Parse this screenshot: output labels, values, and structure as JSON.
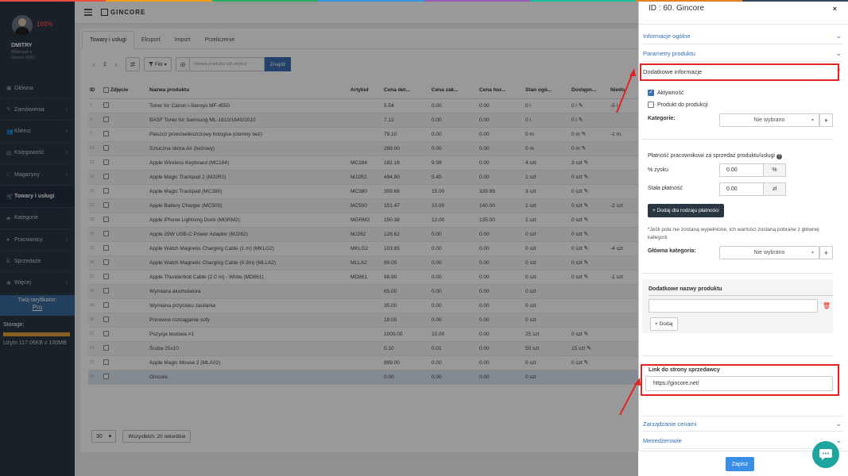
{
  "colors": {
    "strip": [
      "#e74c3c",
      "#f39c12",
      "#27ae60",
      "#3498db",
      "#9b59b6",
      "#1abc9c",
      "#e67e22",
      "#34495e"
    ],
    "accent": "#3a6fb5",
    "highlight": "#e02424"
  },
  "profile": {
    "percent": "100%",
    "name": "DMITRY",
    "role": "Właściciel ▾",
    "stat": "Ocena: 10/10"
  },
  "nav": [
    {
      "label": "Główna",
      "icon": "dashboard-icon",
      "glyph": "▣",
      "chev": ""
    },
    {
      "label": "Zamówienia",
      "icon": "orders-icon",
      "glyph": "✎",
      "chev": "‹"
    },
    {
      "label": "Klienci",
      "icon": "clients-icon",
      "glyph": "👥",
      "chev": "‹"
    },
    {
      "label": "Księgowość",
      "icon": "accounting-icon",
      "glyph": "▤",
      "chev": "‹"
    },
    {
      "label": "Magazyny",
      "icon": "warehouse-icon",
      "glyph": "⌂",
      "chev": "‹"
    },
    {
      "label": "Towary i usługi",
      "icon": "cart-icon",
      "glyph": "🛒",
      "chev": ""
    },
    {
      "label": "Kategorie",
      "icon": "folder-icon",
      "glyph": "▰",
      "chev": ""
    },
    {
      "label": "Pracownicy",
      "icon": "employees-icon",
      "glyph": "●",
      "chev": "‹"
    },
    {
      "label": "Sprzedaże",
      "icon": "dollar-icon",
      "glyph": "$",
      "chev": ""
    },
    {
      "label": "Więcej",
      "icon": "gear-icon",
      "glyph": "✱",
      "chev": "‹"
    }
  ],
  "tariff": {
    "label": "Twój taryfikator:",
    "plan": "Pro"
  },
  "storage": {
    "label": "Storage:",
    "used": "Użyto 117.06KB z 100MB",
    "fraction": 0.0011
  },
  "logo": "GINCORE",
  "tabs": [
    "Towary i usługi",
    "Eksport",
    "Import",
    "Przeliczenie"
  ],
  "toolbar": {
    "prev": "‹",
    "page": "1",
    "next": "›",
    "filter": "Filtr ▾",
    "search_placeholder": "Nazwa produktu lub artykuł",
    "find": "Znajdź"
  },
  "table": {
    "headers": [
      "ID",
      "Zdjęcie",
      "Nazwa produktu",
      "Artykuł",
      "Cena det...",
      "Cena zak...",
      "Cena hur...",
      "Stan ogó...",
      "Dostępn...",
      "Niedo"
    ],
    "rows": [
      {
        "id": "1",
        "name": "Toner for Canon i-Sensys MF-4550",
        "art": "",
        "cd": "5.54",
        "cz": "0.00",
        "ch": "0.00",
        "st": "0 l",
        "dos": "0 l",
        "nd": "-5 l",
        "sel": false
      },
      {
        "id": "4",
        "name": "BASF Toner for Samsung ML-1610/1640/2010",
        "art": "",
        "cd": "7.12",
        "cz": "0.00",
        "ch": "0.00",
        "st": "0 l",
        "dos": "0 l",
        "nd": "",
        "sel": false
      },
      {
        "id": "7",
        "name": "Płaszcz przeciwdeszczowy bologna (ciemny bez)",
        "art": "",
        "cd": "79.10",
        "cz": "0.00",
        "ch": "0.00",
        "st": "0 m",
        "dos": "0 m",
        "nd": "-1 m",
        "sel": false
      },
      {
        "id": "10",
        "name": "Sztuczna skóra Air (beżowy)",
        "art": "",
        "cd": "289.00",
        "cz": "0.00",
        "ch": "0.00",
        "st": "0 m",
        "dos": "0 m",
        "nd": "",
        "sel": false
      },
      {
        "id": "13",
        "name": "Apple Wireless Keyboard (MC184)",
        "art": "MC184",
        "cd": "182.16",
        "cz": "9.99",
        "ch": "0.00",
        "st": "4 szt",
        "dos": "3 szt",
        "nd": "",
        "sel": false
      },
      {
        "id": "16",
        "name": "Apple Magic Trackpad 2 (MJ2R2)",
        "art": "MJ2R2",
        "cd": "494.90",
        "cz": "5.45",
        "ch": "0.00",
        "st": "1 szt",
        "dos": "0 szt",
        "nd": "",
        "sel": false
      },
      {
        "id": "19",
        "name": "Apple Magic Trackpad (MC380)",
        "art": "MC380",
        "cd": "359.66",
        "cz": "15.00",
        "ch": "339.99",
        "st": "3 szt",
        "dos": "0 szt",
        "nd": "",
        "sel": false
      },
      {
        "id": "22",
        "name": "Apple Battery Charger (MC500)",
        "art": "MC500",
        "cd": "151.47",
        "cz": "10.00",
        "ch": "140.00",
        "st": "1 szt",
        "dos": "0 szt",
        "nd": "-2 szt",
        "sel": false
      },
      {
        "id": "25",
        "name": "Apple iPhone Lightning Dock (MGRM2)",
        "art": "MGRM2",
        "cd": "150.38",
        "cz": "12.00",
        "ch": "135.00",
        "st": "1 szt",
        "dos": "0 szt",
        "nd": "",
        "sel": false
      },
      {
        "id": "28",
        "name": "Apple 29W USB-C Power Adapter (MJ262)",
        "art": "MJ262",
        "cd": "126.62",
        "cz": "0.00",
        "ch": "0.00",
        "st": "0 szt",
        "dos": "0 szt",
        "nd": "",
        "sel": false
      },
      {
        "id": "31",
        "name": "Apple Watch Magnetic Charging Cable (1 m) (MKLG2)",
        "art": "MKLG2",
        "cd": "103.85",
        "cz": "0.00",
        "ch": "0.00",
        "st": "0 szt",
        "dos": "0 szt",
        "nd": "-4 szt",
        "sel": false
      },
      {
        "id": "34",
        "name": "Apple Watch Magnetic Charging Cable (0.3m) (MLLA2)",
        "art": "MLLA2",
        "cd": "89.00",
        "cz": "0.00",
        "ch": "0.00",
        "st": "0 szt",
        "dos": "0 szt",
        "nd": "",
        "sel": false
      },
      {
        "id": "37",
        "name": "Apple Thunderbolt Cable (2.0 m) - White (MD861)",
        "art": "MD861",
        "cd": "98.90",
        "cz": "0.00",
        "ch": "0.00",
        "st": "0 szt",
        "dos": "0 szt",
        "nd": "-1 szt",
        "sel": false
      },
      {
        "id": "40",
        "name": "Wymiana akumulatora",
        "art": "",
        "cd": "65.00",
        "cz": "0.00",
        "ch": "0.00",
        "st": "0 szt",
        "dos": "",
        "nd": "",
        "sel": false
      },
      {
        "id": "43",
        "name": "Wymiana przycisku zasilania",
        "art": "",
        "cd": "35.00",
        "cz": "0.00",
        "ch": "0.00",
        "st": "0 szt",
        "dos": "",
        "nd": "",
        "sel": false
      },
      {
        "id": "46",
        "name": "Ponowne rozciąganie sofy",
        "art": "",
        "cd": "18.00",
        "cz": "0.00",
        "ch": "0.00",
        "st": "0 szt",
        "dos": "",
        "nd": "",
        "sel": false
      },
      {
        "id": "51",
        "name": "Pozycja testowa #1",
        "art": "",
        "cd": "1000.00",
        "cz": "10.00",
        "ch": "0.00",
        "st": "25 szt",
        "dos": "0 szt",
        "nd": "",
        "sel": false
      },
      {
        "id": "54",
        "name": "Śruba 25x10",
        "art": "",
        "cd": "0.10",
        "cz": "0.01",
        "ch": "0.00",
        "st": "50 szt",
        "dos": "15 szt",
        "nd": "",
        "sel": false
      },
      {
        "id": "57",
        "name": "Apple Magic Mouse 2 (MLA02)",
        "art": "",
        "cd": "999.00",
        "cz": "0.00",
        "ch": "0.00",
        "st": "0 szt",
        "dos": "0 szt",
        "nd": "",
        "sel": false
      },
      {
        "id": "60",
        "name": "Gincore",
        "art": "",
        "cd": "0.00",
        "cz": "0.00",
        "ch": "0.00",
        "st": "0 szt",
        "dos": "",
        "nd": "",
        "sel": true
      }
    ]
  },
  "footer": {
    "per_page": "30",
    "total": "Wszystkich: 20 rekordów"
  },
  "panel": {
    "title": "ID : 60. Gincore",
    "close": "×",
    "sections": {
      "general": "Informacje ogólne",
      "params": "Parametry produktu",
      "extra": "Dodatkowe informacje",
      "prices": "Zarządzanie cenami",
      "managers": "Menedżerowie"
    },
    "active_label": "Aktywność",
    "production_label": "Produkt do produkcji",
    "category_label": "Kategorie:",
    "dropdown_value": "Nie wybrano",
    "pay_title": "Płatność pracownikowi za sprzedaż produktu/usługi",
    "percent_label": "% zysku",
    "percent_value": "0.00",
    "percent_unit": "%",
    "fixed_label": "Stała płatność",
    "fixed_value": "0.00",
    "fixed_unit": "zł",
    "add_pay_button": "+ Dodaj dla rodzaju płatności",
    "note": "*Jeśli pola nie zostaną wypełnione, ich wartości zostaną pobrane z głównej kategorii",
    "main_category_label": "Główna kategoria:",
    "extra_names_title": "Dodatkowe nazwy produktu",
    "add_button": "+ Dodaj",
    "link_title": "Link do strony sprzedawcy",
    "link_value": "https://gincore.net/",
    "save": "Zapisz"
  }
}
